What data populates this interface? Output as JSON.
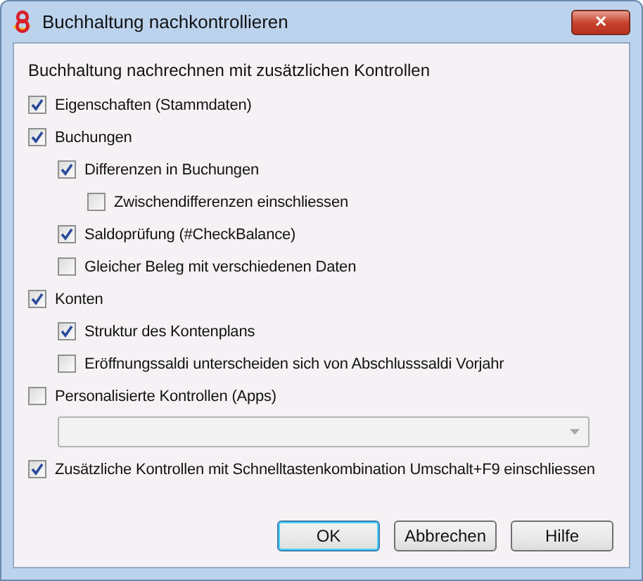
{
  "window": {
    "title": "Buchhaltung nachkontrollieren",
    "close_label": "✕"
  },
  "intro": "Buchhaltung nachrechnen mit zusätzlichen Kontrollen",
  "options": [
    {
      "kind": "checkbox",
      "label": "Eigenschaften (Stammdaten)",
      "checked": true
    },
    {
      "kind": "checkbox",
      "label": "Buchungen",
      "checked": true,
      "children": [
        {
          "kind": "checkbox",
          "label": "Differenzen in Buchungen",
          "checked": true,
          "children": [
            {
              "kind": "checkbox",
              "label": "Zwischendifferenzen einschliessen",
              "checked": false
            }
          ]
        },
        {
          "kind": "checkbox",
          "label": "Saldoprüfung (#CheckBalance)",
          "checked": true
        },
        {
          "kind": "checkbox",
          "label": "Gleicher Beleg mit verschiedenen Daten",
          "checked": false
        }
      ]
    },
    {
      "kind": "checkbox",
      "label": "Konten",
      "checked": true,
      "children": [
        {
          "kind": "checkbox",
          "label": "Struktur des Kontenplans",
          "checked": true
        },
        {
          "kind": "checkbox",
          "label": "Eröffnungssaldi unterscheiden sich von Abschlusssaldi Vorjahr",
          "checked": false
        }
      ]
    },
    {
      "kind": "checkbox",
      "label": "Personalisierte Kontrollen (Apps)",
      "checked": false
    },
    {
      "kind": "dropdown",
      "disabled": true
    },
    {
      "kind": "checkbox",
      "label": "Zusätzliche Kontrollen mit Schnelltastenkombination Umschalt+F9 einschliessen",
      "checked": true
    }
  ],
  "buttons": [
    {
      "label": "OK",
      "selected": true
    },
    {
      "label": "Abbrechen",
      "selected": false
    },
    {
      "label": "Hilfe",
      "selected": false
    }
  ]
}
